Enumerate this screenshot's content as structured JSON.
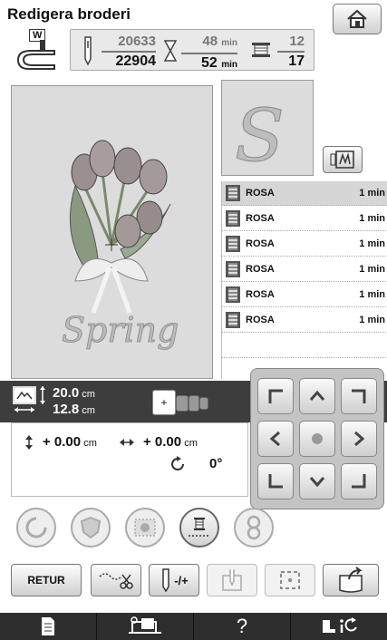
{
  "header": {
    "title": "Redigera broderi"
  },
  "stats": {
    "needle_label": "W",
    "stitches_current": "20633",
    "stitches_total": "22904",
    "time_current": "48",
    "time_total": "52",
    "time_unit": "min",
    "colors_current": "12",
    "colors_total": "17"
  },
  "color_list": [
    {
      "name": "ROSA",
      "time": "1 min"
    },
    {
      "name": "ROSA",
      "time": "1 min"
    },
    {
      "name": "ROSA",
      "time": "1 min"
    },
    {
      "name": "ROSA",
      "time": "1 min"
    },
    {
      "name": "ROSA",
      "time": "1 min"
    },
    {
      "name": "ROSA",
      "time": "1 min"
    }
  ],
  "preview": {
    "design_text": "Spring",
    "thumb_letter": "S"
  },
  "size": {
    "width": "20.0",
    "height": "12.8",
    "unit": "cm"
  },
  "position": {
    "y": "+ 0.00",
    "x": "+ 0.00",
    "unit": "cm",
    "angle": "0°"
  },
  "buttons": {
    "back_label": "RETUR",
    "needle_toggle": "-/+"
  },
  "bottom_bar": {
    "help": "?"
  },
  "colors": {
    "band": "#3d3d3d",
    "bottom_bar": "#2e2e2e",
    "selected_row": "#d6d6d6"
  }
}
